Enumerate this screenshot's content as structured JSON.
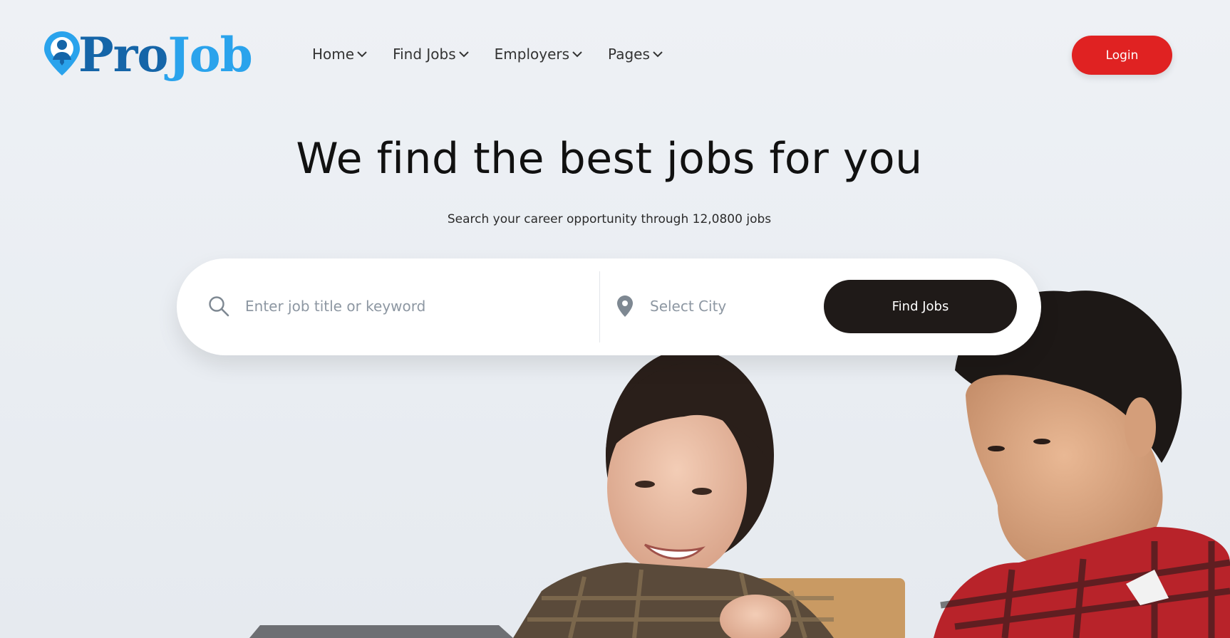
{
  "brand": {
    "name_part1": "Pro",
    "name_part2": "Job"
  },
  "nav": {
    "items": [
      {
        "label": "Home"
      },
      {
        "label": "Find Jobs"
      },
      {
        "label": "Employers"
      },
      {
        "label": "Pages"
      }
    ]
  },
  "header": {
    "login_label": "Login"
  },
  "hero": {
    "title": "We find the best jobs for you",
    "subtitle": "Search your career opportunity through 12,0800 jobs"
  },
  "search": {
    "keyword_placeholder": "Enter job title or keyword",
    "city_placeholder": "Select City",
    "submit_label": "Find Jobs"
  },
  "colors": {
    "brand_dark_blue": "#1565a8",
    "brand_light_blue": "#2aa3ec",
    "login_red": "#e02222",
    "find_button": "#1f1a18"
  },
  "icons": {
    "logo": "location-pin-person-icon",
    "search": "search-icon",
    "location": "location-pin-icon",
    "nav_dropdown": "chevron-down-icon"
  }
}
